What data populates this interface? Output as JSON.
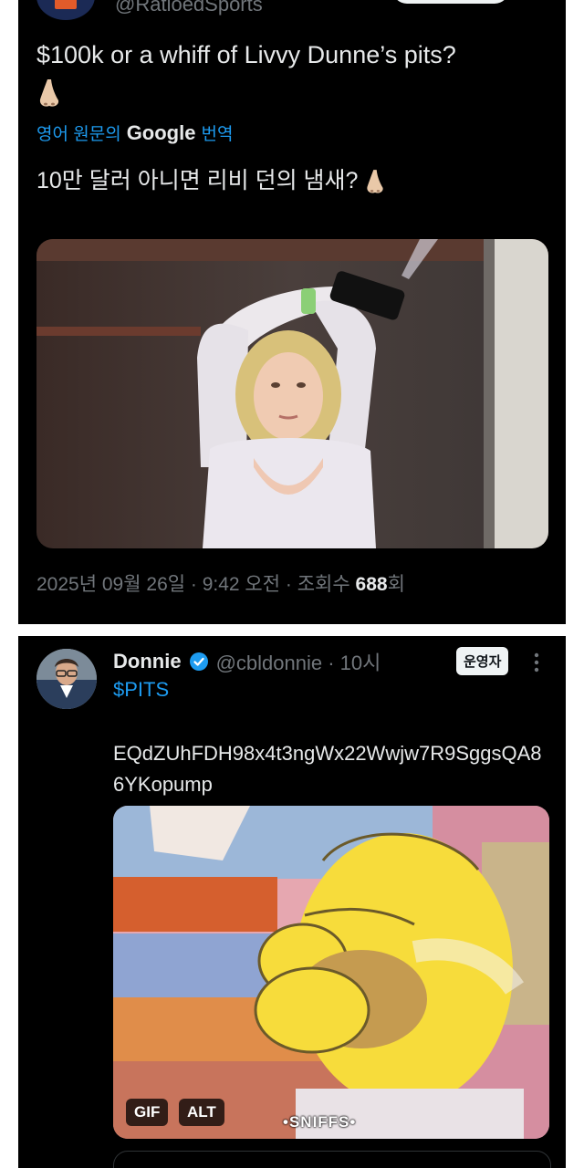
{
  "tweet1": {
    "handle": "@RatioedSports",
    "text": "$100k or a whiff of Livvy Dunne’s pits?",
    "translate": {
      "prefix": "영어 원문의",
      "brand": "Google",
      "suffix": "번역"
    },
    "translated": "10만 달러 아니면 리비 던의 냄새?",
    "meta": {
      "date": "2025년 09월 26일 · 9:42 오전 · 조회수",
      "views": "688",
      "views_unit": "회"
    }
  },
  "tweet2": {
    "name": "Donnie",
    "handle": "@cbldonnie · 10시",
    "badge": "운영자",
    "ticker": "$PITS",
    "contract": "EQdZUhFDH98x4t3ngWx22Wwjw7R9SggsQA86YKopump",
    "gif_label": "GIF",
    "alt_label": "ALT",
    "caption": "•SNIFFS•"
  },
  "colors": {
    "background": "#000000",
    "text": "#e7e9ea",
    "muted": "#71767b",
    "link": "#1d9bf0"
  },
  "icons": [
    "nose-emoji",
    "verified-icon",
    "more-icon"
  ]
}
